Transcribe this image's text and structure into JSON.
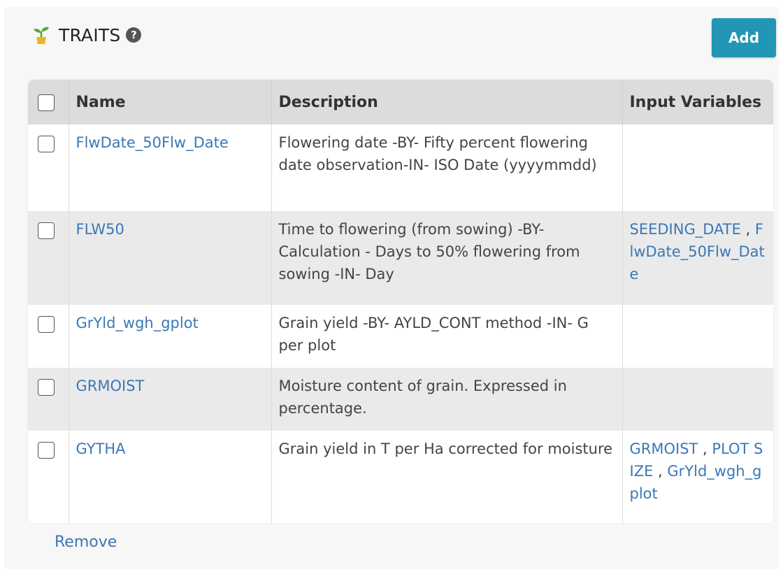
{
  "header": {
    "title": "TRAITS",
    "help_icon": "?",
    "add_label": "Add"
  },
  "table": {
    "columns": [
      "Name",
      "Description",
      "Input Variables"
    ],
    "rows": [
      {
        "name": "FlwDate_50Flw_Date",
        "description": "Flowering date -BY- Fifty percent flowering date observation-IN- ISO Date (yyyymmdd)",
        "inputs": []
      },
      {
        "name": "FLW50",
        "description": "Time to flowering (from sowing) -BY- Calculation - Days to 50% flowering from sowing -IN- Day",
        "inputs": [
          "SEEDING_DATE",
          "FlwDate_50Flw_Date"
        ]
      },
      {
        "name": "GrYld_wgh_gplot",
        "description": "Grain yield -BY- AYLD_CONT method -IN- G per plot",
        "inputs": []
      },
      {
        "name": "GRMOIST",
        "description": "Moisture content of grain. Expressed in percentage.",
        "inputs": []
      },
      {
        "name": "GYTHA",
        "description": "Grain yield in T per Ha corrected for moisture",
        "inputs": [
          "GRMOIST",
          "PLOT SIZE",
          "GrYld_wgh_gplot"
        ]
      }
    ]
  },
  "footer": {
    "remove_label": "Remove"
  },
  "colors": {
    "accent": "#2196b5",
    "link": "#3b78b5",
    "header_bg": "#dcdcdc",
    "stripe": "#eaeaea"
  },
  "icons": {
    "logo": "sprout-icon",
    "help": "help-icon"
  }
}
